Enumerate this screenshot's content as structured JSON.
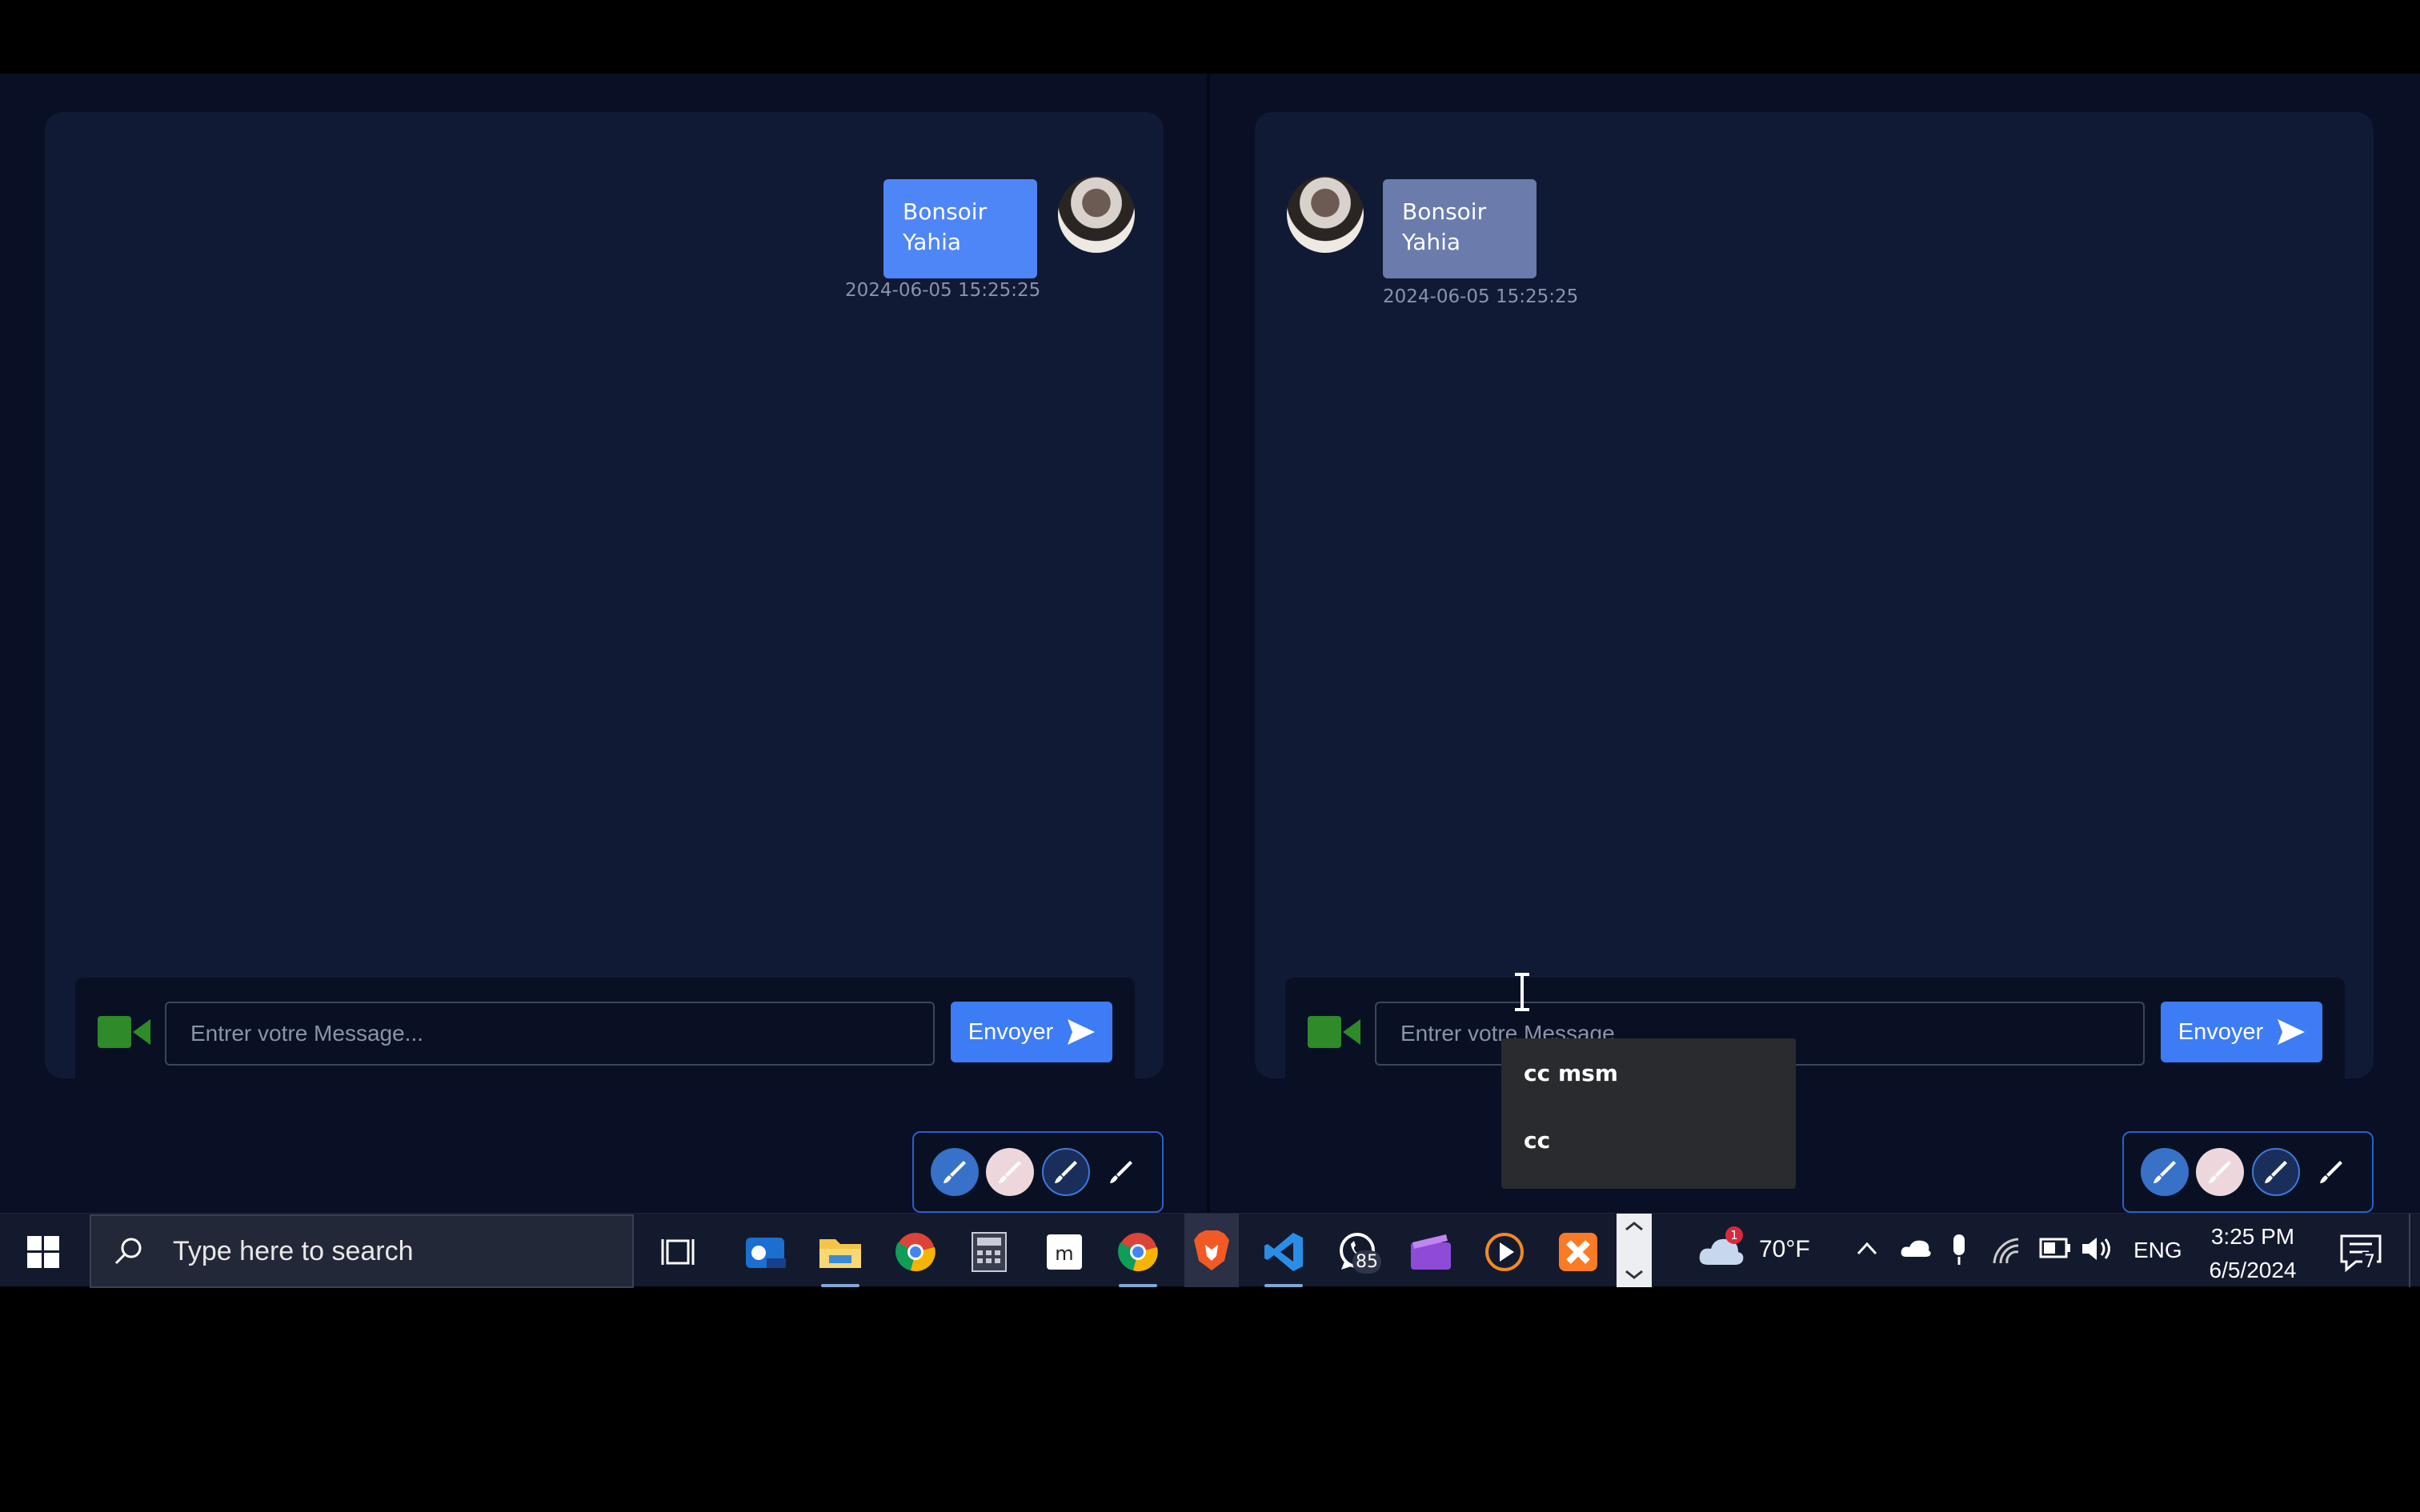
{
  "left_chat": {
    "message": {
      "text_line1": "Bonsoir",
      "text_line2": "Yahia",
      "timestamp": "2024-06-05 15:25:25"
    },
    "input": {
      "placeholder": "Entrer votre Message...",
      "value": ""
    },
    "send_label": "Envoyer"
  },
  "right_chat": {
    "message": {
      "text_line1": "Bonsoir",
      "text_line2": "Yahia",
      "timestamp": "2024-06-05 15:25:25"
    },
    "input": {
      "placeholder": "Entrer votre Message...",
      "value": ""
    },
    "send_label": "Envoyer",
    "autocomplete": [
      "cc msm",
      "cc"
    ]
  },
  "toolbar_icons": [
    "brush-blue-icon",
    "brush-pink-icon",
    "brush-navy-icon",
    "brush-dark-icon"
  ],
  "colors": {
    "accent": "#3d7cf5",
    "bubble_sent": "#4f86f7",
    "bubble_received": "#6a7bac",
    "card": "#101a35",
    "background": "#090f24"
  },
  "taskbar": {
    "search_placeholder": "Type here to search",
    "whatsapp_badge": "85",
    "weather_badge": "1",
    "temperature": "70°F",
    "language": "ENG",
    "time": "3:25 PM",
    "date": "6/5/2024",
    "notification_count": "7"
  }
}
